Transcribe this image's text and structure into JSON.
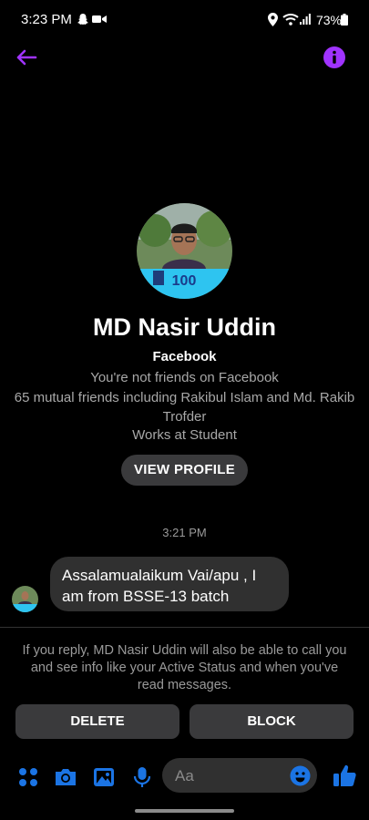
{
  "status_bar": {
    "time": "3:23 PM",
    "battery": "73%"
  },
  "header": {
    "back_icon": "arrow-left-icon",
    "info_icon": "info-icon",
    "accent": "#a033ff"
  },
  "profile": {
    "name": "MD Nasir Uddin",
    "app": "Facebook",
    "friend_status": "You're not friends on Facebook",
    "mutual_friends": "65 mutual friends including Rakibul Islam and Md. Rakib Trofder",
    "work": "Works at Student",
    "view_profile_label": "VIEW PROFILE"
  },
  "conversation": {
    "timestamp": "3:21 PM",
    "message": "Assalamualaikum Vai/apu , I am from BSSE-13 batch"
  },
  "request": {
    "notice": "If you reply, MD Nasir Uddin will also be able to call you and see info like your Active Status and when you've read messages.",
    "delete_label": "DELETE",
    "block_label": "BLOCK"
  },
  "composer": {
    "placeholder": "Aa",
    "icons": [
      "apps-icon",
      "camera-icon",
      "gallery-icon",
      "microphone-icon",
      "emoji-icon",
      "thumbs-up-icon"
    ],
    "accent": "#1b74e4"
  }
}
